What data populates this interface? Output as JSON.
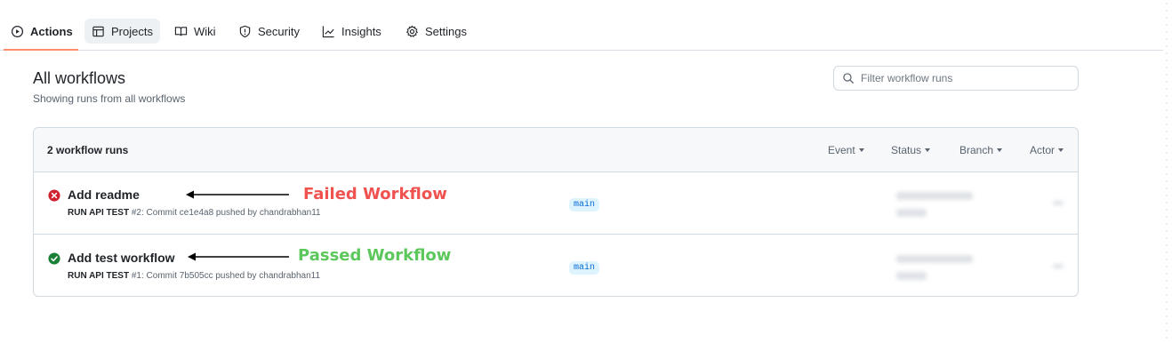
{
  "nav": {
    "tabs": [
      {
        "label": "Actions",
        "icon": "play-icon",
        "active": true
      },
      {
        "label": "Projects",
        "icon": "table-icon"
      },
      {
        "label": "Wiki",
        "icon": "book-icon"
      },
      {
        "label": "Security",
        "icon": "shield-icon"
      },
      {
        "label": "Insights",
        "icon": "graph-icon"
      },
      {
        "label": "Settings",
        "icon": "gear-icon"
      }
    ]
  },
  "header": {
    "title": "All workflows",
    "subtitle": "Showing runs from all workflows",
    "filter_placeholder": "Filter workflow runs"
  },
  "runs_box": {
    "count_label": "2 workflow runs",
    "filters": [
      "Event",
      "Status",
      "Branch",
      "Actor"
    ],
    "runs": [
      {
        "title": "Add readme",
        "workflow": "RUN API TEST",
        "meta": " #2: Commit ce1e4a8 pushed by chandrabhan11",
        "branch": "main",
        "status": "failure",
        "annotation": "Failed Workflow"
      },
      {
        "title": "Add test workflow",
        "workflow": "RUN API TEST",
        "meta": " #1: Commit 7b505cc pushed by chandrabhan11",
        "branch": "main",
        "status": "success",
        "annotation": "Passed Workflow"
      }
    ]
  },
  "colors": {
    "failure": "#cf222e",
    "success": "#1a7f37",
    "annotation_failed": "#f0524f",
    "annotation_passed": "#5cc85c",
    "tab_underline": "#fd8c73"
  }
}
